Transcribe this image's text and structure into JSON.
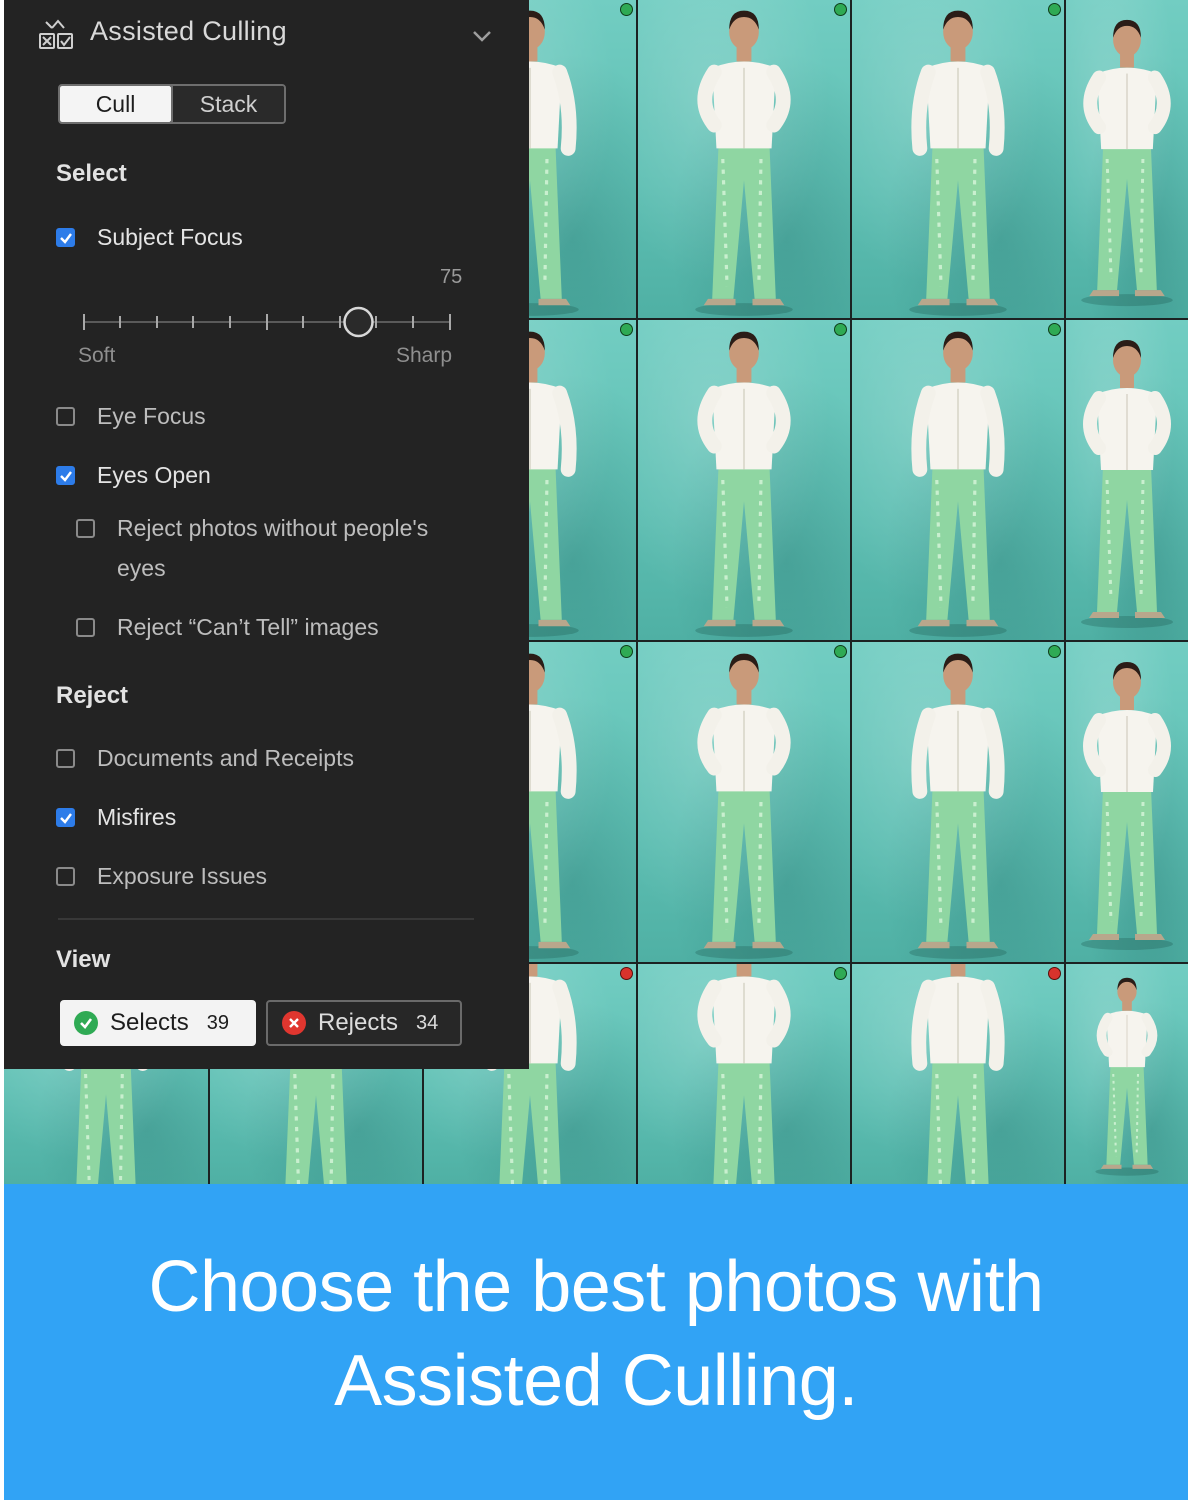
{
  "panel": {
    "title": "Assisted Culling",
    "icons": {
      "header": "culling-icon",
      "collapse": "chevron-down-icon"
    },
    "mode_tabs": [
      {
        "label": "Cull",
        "active": true
      },
      {
        "label": "Stack",
        "active": false
      }
    ],
    "select": {
      "heading": "Select",
      "subject_focus": {
        "label": "Subject Focus",
        "checked": true
      },
      "slider": {
        "value": "75",
        "min_label": "Soft",
        "max_label": "Sharp",
        "level_fraction": 0.75
      },
      "eye_focus": {
        "label": "Eye Focus",
        "checked": false
      },
      "eyes_open": {
        "label": "Eyes Open",
        "checked": true
      },
      "no_eyes": {
        "label_line1": "Reject photos without people's",
        "label_line2": "eyes",
        "checked": false
      },
      "cant_tell": {
        "label": "Reject “Can’t Tell” images",
        "checked": false
      }
    },
    "reject": {
      "heading": "Reject",
      "documents": {
        "label": "Documents and Receipts",
        "checked": false
      },
      "misfires": {
        "label": "Misfires",
        "checked": true
      },
      "exposure": {
        "label": "Exposure Issues",
        "checked": false
      }
    },
    "view": {
      "heading": "View",
      "selects": {
        "label": "Selects",
        "count": "39",
        "icon": "check-circle-icon",
        "color": "#2faa54"
      },
      "rejects": {
        "label": "Rejects",
        "count": "34",
        "icon": "x-circle-icon",
        "color": "#e0362f"
      }
    }
  },
  "grid": {
    "badges": [
      [
        "select",
        "select",
        "select",
        "none"
      ],
      [
        "select",
        "select",
        "select",
        "none"
      ],
      [
        "select",
        "select",
        "select",
        "none"
      ],
      [
        "reject",
        "select",
        "reject",
        "none"
      ]
    ]
  },
  "banner": {
    "line1": "Choose the best photos with",
    "line2": "Assisted Culling.",
    "color": "#31a3f5"
  }
}
